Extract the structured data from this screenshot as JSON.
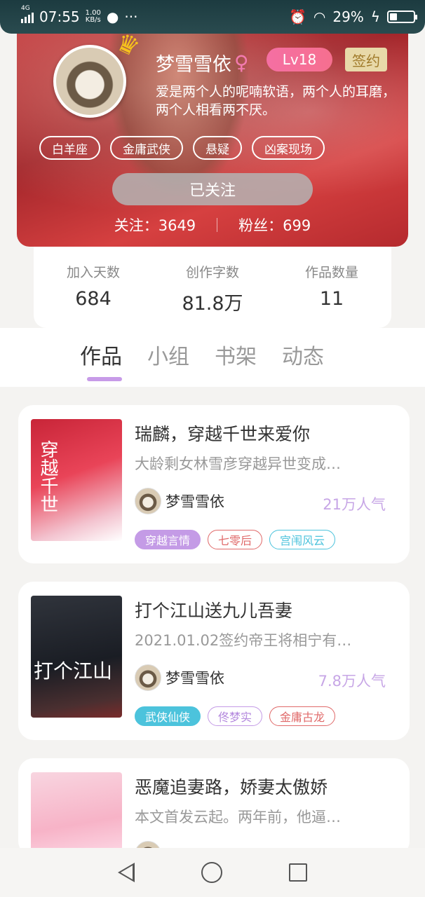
{
  "status_bar": {
    "network": "4G",
    "time": "07:55",
    "speed": "1.00",
    "speed_unit": "KB/s",
    "more": "···",
    "battery": "29%"
  },
  "profile": {
    "name": "梦雪雪依",
    "gender_symbol": "♀",
    "level": "Lv18",
    "sign_badge": "签约",
    "bio": "爱是两个人的呢喃软语，两个人的耳磨，两个人相看两不厌。",
    "tags": [
      "白羊座",
      "金庸武侠",
      "悬疑",
      "凶案现场"
    ],
    "follow_button": "已关注",
    "following": "关注：3649",
    "fans": "粉丝：699"
  },
  "stats": [
    {
      "label": "加入天数",
      "value": "684"
    },
    {
      "label": "创作字数",
      "value": "81.8万"
    },
    {
      "label": "作品数量",
      "value": "11"
    }
  ],
  "tabs": [
    "作品",
    "小组",
    "书架",
    "动态"
  ],
  "active_tab": "作品",
  "books": [
    {
      "title": "瑞麟，穿越千世来爱你",
      "desc": "大龄剩女林雪彦穿越异世变成…",
      "author": "梦雪雪依",
      "popularity": "21万人气",
      "cover_text": "穿越千世",
      "tags": [
        {
          "label": "穿越言情",
          "style": "fill-purple"
        },
        {
          "label": "七零后",
          "style": "outline-red"
        },
        {
          "label": "宫闱风云",
          "style": "outline-cyan"
        }
      ]
    },
    {
      "title": "打个江山送九儿吾妻",
      "desc": "2021.01.02签约帝王将相宁有…",
      "author": "梦雪雪依",
      "popularity": "7.8万人气",
      "cover_text": "打个江山",
      "tags": [
        {
          "label": "武侠仙侠",
          "style": "fill-cyan"
        },
        {
          "label": "佟梦实",
          "style": "outline-purple"
        },
        {
          "label": "金庸古龙",
          "style": "outline-red"
        }
      ]
    },
    {
      "title": "恶魔追妻路，娇妻太傲娇",
      "desc": "本文首发云起。两年前，他逼…",
      "author": "",
      "popularity": "",
      "cover_text": "",
      "tags": []
    }
  ],
  "colors": {
    "accent_purple": "#c79be8",
    "popularity": "#c7a6e6",
    "tag_red": "#e06a6a",
    "tag_cyan": "#4cc3dc",
    "level_pink": "#f56fa3"
  },
  "icons": [
    "signal-icon",
    "qq-icon",
    "alarm-icon",
    "wifi-icon",
    "charging-icon",
    "battery-icon",
    "crown-icon",
    "nav-back-icon",
    "nav-home-icon",
    "nav-recent-icon"
  ]
}
